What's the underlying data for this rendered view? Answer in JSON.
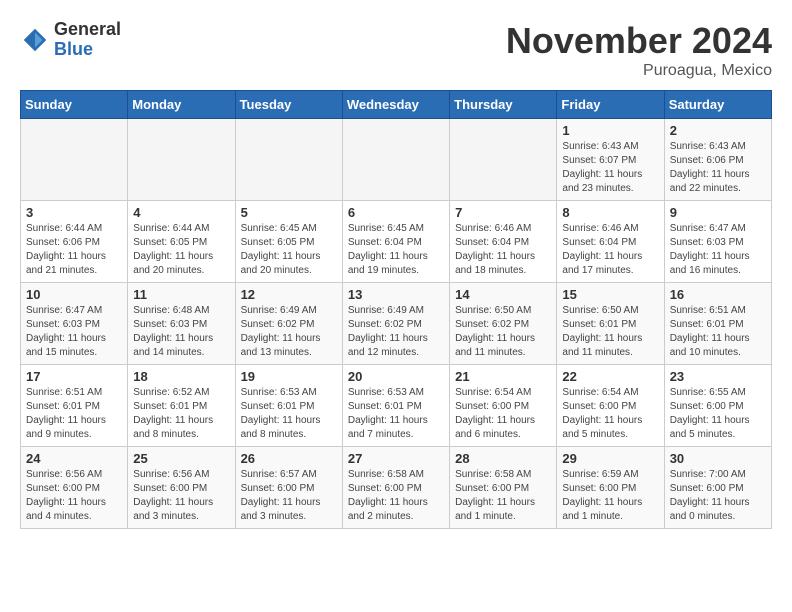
{
  "logo": {
    "general": "General",
    "blue": "Blue"
  },
  "title": "November 2024",
  "location": "Puroagua, Mexico",
  "days_of_week": [
    "Sunday",
    "Monday",
    "Tuesday",
    "Wednesday",
    "Thursday",
    "Friday",
    "Saturday"
  ],
  "weeks": [
    [
      {
        "day": "",
        "sunrise": "",
        "sunset": "",
        "daylight": ""
      },
      {
        "day": "",
        "sunrise": "",
        "sunset": "",
        "daylight": ""
      },
      {
        "day": "",
        "sunrise": "",
        "sunset": "",
        "daylight": ""
      },
      {
        "day": "",
        "sunrise": "",
        "sunset": "",
        "daylight": ""
      },
      {
        "day": "",
        "sunrise": "",
        "sunset": "",
        "daylight": ""
      },
      {
        "day": "1",
        "sunrise": "Sunrise: 6:43 AM",
        "sunset": "Sunset: 6:07 PM",
        "daylight": "Daylight: 11 hours and 23 minutes."
      },
      {
        "day": "2",
        "sunrise": "Sunrise: 6:43 AM",
        "sunset": "Sunset: 6:06 PM",
        "daylight": "Daylight: 11 hours and 22 minutes."
      }
    ],
    [
      {
        "day": "3",
        "sunrise": "Sunrise: 6:44 AM",
        "sunset": "Sunset: 6:06 PM",
        "daylight": "Daylight: 11 hours and 21 minutes."
      },
      {
        "day": "4",
        "sunrise": "Sunrise: 6:44 AM",
        "sunset": "Sunset: 6:05 PM",
        "daylight": "Daylight: 11 hours and 20 minutes."
      },
      {
        "day": "5",
        "sunrise": "Sunrise: 6:45 AM",
        "sunset": "Sunset: 6:05 PM",
        "daylight": "Daylight: 11 hours and 20 minutes."
      },
      {
        "day": "6",
        "sunrise": "Sunrise: 6:45 AM",
        "sunset": "Sunset: 6:04 PM",
        "daylight": "Daylight: 11 hours and 19 minutes."
      },
      {
        "day": "7",
        "sunrise": "Sunrise: 6:46 AM",
        "sunset": "Sunset: 6:04 PM",
        "daylight": "Daylight: 11 hours and 18 minutes."
      },
      {
        "day": "8",
        "sunrise": "Sunrise: 6:46 AM",
        "sunset": "Sunset: 6:04 PM",
        "daylight": "Daylight: 11 hours and 17 minutes."
      },
      {
        "day": "9",
        "sunrise": "Sunrise: 6:47 AM",
        "sunset": "Sunset: 6:03 PM",
        "daylight": "Daylight: 11 hours and 16 minutes."
      }
    ],
    [
      {
        "day": "10",
        "sunrise": "Sunrise: 6:47 AM",
        "sunset": "Sunset: 6:03 PM",
        "daylight": "Daylight: 11 hours and 15 minutes."
      },
      {
        "day": "11",
        "sunrise": "Sunrise: 6:48 AM",
        "sunset": "Sunset: 6:03 PM",
        "daylight": "Daylight: 11 hours and 14 minutes."
      },
      {
        "day": "12",
        "sunrise": "Sunrise: 6:49 AM",
        "sunset": "Sunset: 6:02 PM",
        "daylight": "Daylight: 11 hours and 13 minutes."
      },
      {
        "day": "13",
        "sunrise": "Sunrise: 6:49 AM",
        "sunset": "Sunset: 6:02 PM",
        "daylight": "Daylight: 11 hours and 12 minutes."
      },
      {
        "day": "14",
        "sunrise": "Sunrise: 6:50 AM",
        "sunset": "Sunset: 6:02 PM",
        "daylight": "Daylight: 11 hours and 11 minutes."
      },
      {
        "day": "15",
        "sunrise": "Sunrise: 6:50 AM",
        "sunset": "Sunset: 6:01 PM",
        "daylight": "Daylight: 11 hours and 11 minutes."
      },
      {
        "day": "16",
        "sunrise": "Sunrise: 6:51 AM",
        "sunset": "Sunset: 6:01 PM",
        "daylight": "Daylight: 11 hours and 10 minutes."
      }
    ],
    [
      {
        "day": "17",
        "sunrise": "Sunrise: 6:51 AM",
        "sunset": "Sunset: 6:01 PM",
        "daylight": "Daylight: 11 hours and 9 minutes."
      },
      {
        "day": "18",
        "sunrise": "Sunrise: 6:52 AM",
        "sunset": "Sunset: 6:01 PM",
        "daylight": "Daylight: 11 hours and 8 minutes."
      },
      {
        "day": "19",
        "sunrise": "Sunrise: 6:53 AM",
        "sunset": "Sunset: 6:01 PM",
        "daylight": "Daylight: 11 hours and 8 minutes."
      },
      {
        "day": "20",
        "sunrise": "Sunrise: 6:53 AM",
        "sunset": "Sunset: 6:01 PM",
        "daylight": "Daylight: 11 hours and 7 minutes."
      },
      {
        "day": "21",
        "sunrise": "Sunrise: 6:54 AM",
        "sunset": "Sunset: 6:00 PM",
        "daylight": "Daylight: 11 hours and 6 minutes."
      },
      {
        "day": "22",
        "sunrise": "Sunrise: 6:54 AM",
        "sunset": "Sunset: 6:00 PM",
        "daylight": "Daylight: 11 hours and 5 minutes."
      },
      {
        "day": "23",
        "sunrise": "Sunrise: 6:55 AM",
        "sunset": "Sunset: 6:00 PM",
        "daylight": "Daylight: 11 hours and 5 minutes."
      }
    ],
    [
      {
        "day": "24",
        "sunrise": "Sunrise: 6:56 AM",
        "sunset": "Sunset: 6:00 PM",
        "daylight": "Daylight: 11 hours and 4 minutes."
      },
      {
        "day": "25",
        "sunrise": "Sunrise: 6:56 AM",
        "sunset": "Sunset: 6:00 PM",
        "daylight": "Daylight: 11 hours and 3 minutes."
      },
      {
        "day": "26",
        "sunrise": "Sunrise: 6:57 AM",
        "sunset": "Sunset: 6:00 PM",
        "daylight": "Daylight: 11 hours and 3 minutes."
      },
      {
        "day": "27",
        "sunrise": "Sunrise: 6:58 AM",
        "sunset": "Sunset: 6:00 PM",
        "daylight": "Daylight: 11 hours and 2 minutes."
      },
      {
        "day": "28",
        "sunrise": "Sunrise: 6:58 AM",
        "sunset": "Sunset: 6:00 PM",
        "daylight": "Daylight: 11 hours and 1 minute."
      },
      {
        "day": "29",
        "sunrise": "Sunrise: 6:59 AM",
        "sunset": "Sunset: 6:00 PM",
        "daylight": "Daylight: 11 hours and 1 minute."
      },
      {
        "day": "30",
        "sunrise": "Sunrise: 7:00 AM",
        "sunset": "Sunset: 6:00 PM",
        "daylight": "Daylight: 11 hours and 0 minutes."
      }
    ]
  ]
}
